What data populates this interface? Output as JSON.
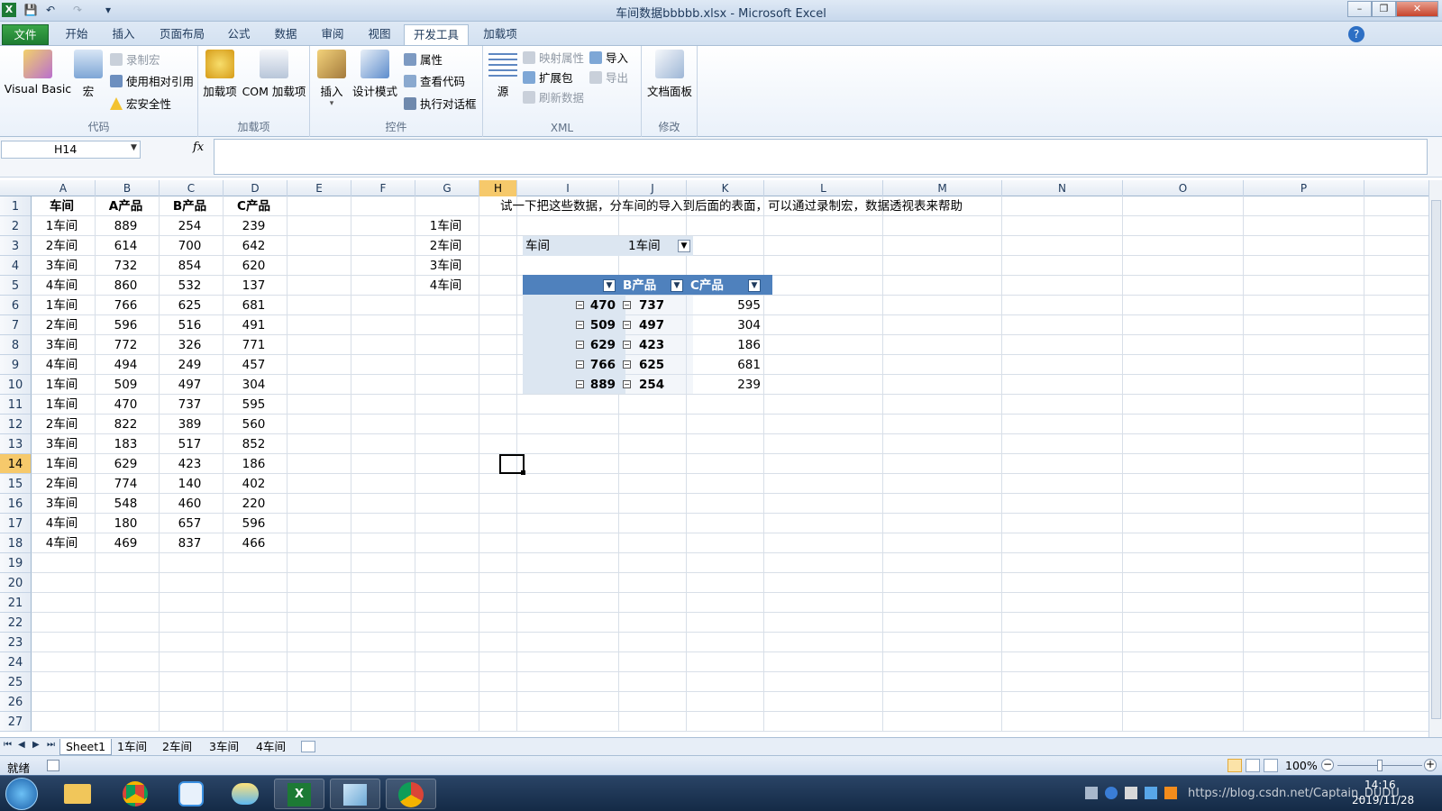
{
  "window": {
    "title": "车间数据bbbbb.xlsx - Microsoft Excel",
    "minimize": "–",
    "restore": "❐",
    "close": "✕"
  },
  "qat": {
    "save": "💾",
    "undo": "↶",
    "redo": "↷",
    "customize": "▾"
  },
  "tabs": [
    "文件",
    "开始",
    "插入",
    "页面布局",
    "公式",
    "数据",
    "审阅",
    "视图",
    "开发工具",
    "加载项"
  ],
  "active_tab": "开发工具",
  "ribbon": {
    "code": {
      "label": "代码",
      "visual_basic": "Visual Basic",
      "macros": "宏",
      "record_macro": "录制宏",
      "relative_ref": "使用相对引用",
      "macro_security": "宏安全性"
    },
    "addins": {
      "label": "加载项",
      "addins": "加载项",
      "com_addins": "COM 加载项"
    },
    "controls": {
      "label": "控件",
      "insert": "插入",
      "design_mode": "设计模式",
      "properties": "属性",
      "view_code": "查看代码",
      "run_dialog": "执行对话框"
    },
    "xml": {
      "label": "XML",
      "source": "源",
      "map_props": "映射属性",
      "expansion": "扩展包",
      "refresh": "刷新数据",
      "import": "导入",
      "export": "导出"
    },
    "modify": {
      "label": "修改",
      "doc_panel": "文档面板"
    }
  },
  "formula_bar": {
    "name_box": "H14",
    "fx": "fx",
    "value": ""
  },
  "columns": [
    "A",
    "B",
    "C",
    "D",
    "E",
    "F",
    "G",
    "H",
    "I",
    "J",
    "K",
    "L",
    "M",
    "N",
    "O",
    "P"
  ],
  "selected_column": "H",
  "rows": [
    "1",
    "2",
    "3",
    "4",
    "5",
    "6",
    "7",
    "8",
    "9",
    "10",
    "11",
    "12",
    "13",
    "14",
    "15",
    "16",
    "17",
    "18",
    "19",
    "20",
    "21",
    "22",
    "23",
    "24",
    "25",
    "26",
    "27"
  ],
  "selected_row": "14",
  "table": {
    "headers": [
      "车间",
      "A产品",
      "B产品",
      "C产品"
    ],
    "data": [
      [
        "1车间",
        "889",
        "254",
        "239"
      ],
      [
        "2车间",
        "614",
        "700",
        "642"
      ],
      [
        "3车间",
        "732",
        "854",
        "620"
      ],
      [
        "4车间",
        "860",
        "532",
        "137"
      ],
      [
        "1车间",
        "766",
        "625",
        "681"
      ],
      [
        "2车间",
        "596",
        "516",
        "491"
      ],
      [
        "3车间",
        "772",
        "326",
        "771"
      ],
      [
        "4车间",
        "494",
        "249",
        "457"
      ],
      [
        "1车间",
        "509",
        "497",
        "304"
      ],
      [
        "1车间",
        "470",
        "737",
        "595"
      ],
      [
        "2车间",
        "822",
        "389",
        "560"
      ],
      [
        "3车间",
        "183",
        "517",
        "852"
      ],
      [
        "1车间",
        "629",
        "423",
        "186"
      ],
      [
        "2车间",
        "774",
        "140",
        "402"
      ],
      [
        "3车间",
        "548",
        "460",
        "220"
      ],
      [
        "4车间",
        "180",
        "657",
        "596"
      ],
      [
        "4车间",
        "469",
        "837",
        "466"
      ]
    ]
  },
  "g_list": [
    "1车间",
    "2车间",
    "3车间",
    "4车间"
  ],
  "note": "试一下把这些数据，分车间的导入到后面的表面，可以通过录制宏，数据透视表来帮助",
  "pivot": {
    "filter_label": "车间",
    "filter_value": "1车间",
    "headers": [
      "",
      "B产品",
      "C产品"
    ],
    "rows": [
      [
        "470",
        "737",
        "595"
      ],
      [
        "509",
        "497",
        "304"
      ],
      [
        "629",
        "423",
        "186"
      ],
      [
        "766",
        "625",
        "681"
      ],
      [
        "889",
        "254",
        "239"
      ]
    ]
  },
  "sheet_tabs": [
    "Sheet1",
    "1车间",
    "2车间",
    "3车间",
    "4车间"
  ],
  "active_sheet": "Sheet1",
  "status": {
    "mode": "就绪",
    "zoom": "100%"
  },
  "taskbar": {
    "time": "14:16",
    "date": "2019/11/28",
    "watermark": "https://blog.csdn.net/Captain_DUDU"
  },
  "colors": {
    "accent": "#4f81bd",
    "file_tab": "#2a8f3c",
    "pivot_row": "#dce6f1",
    "selection": "#f6c96b"
  }
}
